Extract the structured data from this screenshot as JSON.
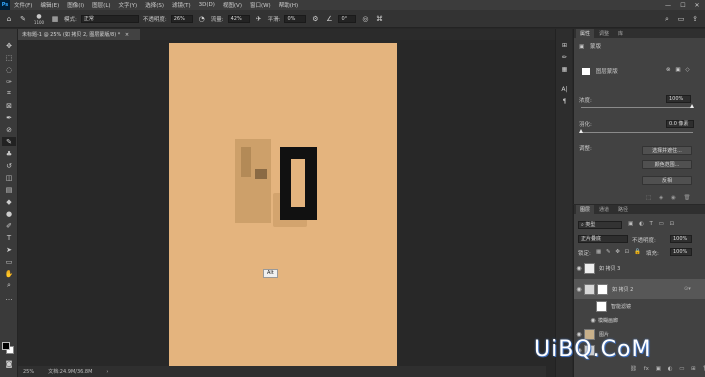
{
  "menubar": {
    "logo": "Ps",
    "items": [
      "文件(F)",
      "编辑(E)",
      "图像(I)",
      "图层(L)",
      "文字(Y)",
      "选择(S)",
      "滤镜(T)",
      "3D(D)",
      "视图(V)",
      "窗口(W)",
      "帮助(H)"
    ],
    "window_controls": [
      "—",
      "☐",
      "✕"
    ]
  },
  "options": {
    "brush_size": "1100",
    "mode_label": "模式:",
    "mode_value": "正常",
    "opacity_label": "不透明度:",
    "opacity_value": "26%",
    "flow_label": "流量:",
    "flow_value": "42%",
    "smooth_label": "平滑:",
    "smooth_value": "0%",
    "angle_value": "0°"
  },
  "document": {
    "tab_title": "未标题-1 @ 25% (如 拷贝 2, 图层蒙版/8) *"
  },
  "canvas": {
    "artboard_color": "#e4b47e",
    "tooltip": "Alt"
  },
  "status": {
    "zoom": "25%",
    "doc_info": "文档:24.9M/36.8M"
  },
  "properties_panel": {
    "tabs": [
      "属性",
      "调整",
      "库"
    ],
    "header_label": "蒙版",
    "mask_type": "图层蒙版",
    "density_label": "浓度:",
    "density_value": "100%",
    "feather_label": "羽化:",
    "feather_value": "0.0 像素",
    "refine_label": "调整:",
    "btn_select_mask": "选择并遮住...",
    "btn_color_range": "颜色范围...",
    "btn_invert": "反相"
  },
  "layers_panel": {
    "tabs": [
      "图层",
      "通道",
      "路径"
    ],
    "filter_kind": "类型",
    "blend_mode": "正片叠底",
    "opacity_label": "不透明度:",
    "opacity_value": "100%",
    "lock_label": "锁定:",
    "fill_label": "填充:",
    "fill_value": "100%",
    "layers": [
      {
        "name": "如 拷贝 3",
        "selected": false
      },
      {
        "name": "如 拷贝 2",
        "selected": true
      },
      {
        "name": "智能滤镜",
        "selected": false
      },
      {
        "name": "模糊画廊",
        "selected": false
      },
      {
        "name": "图片",
        "selected": false
      }
    ]
  },
  "watermark": "UiBQ.CoM"
}
